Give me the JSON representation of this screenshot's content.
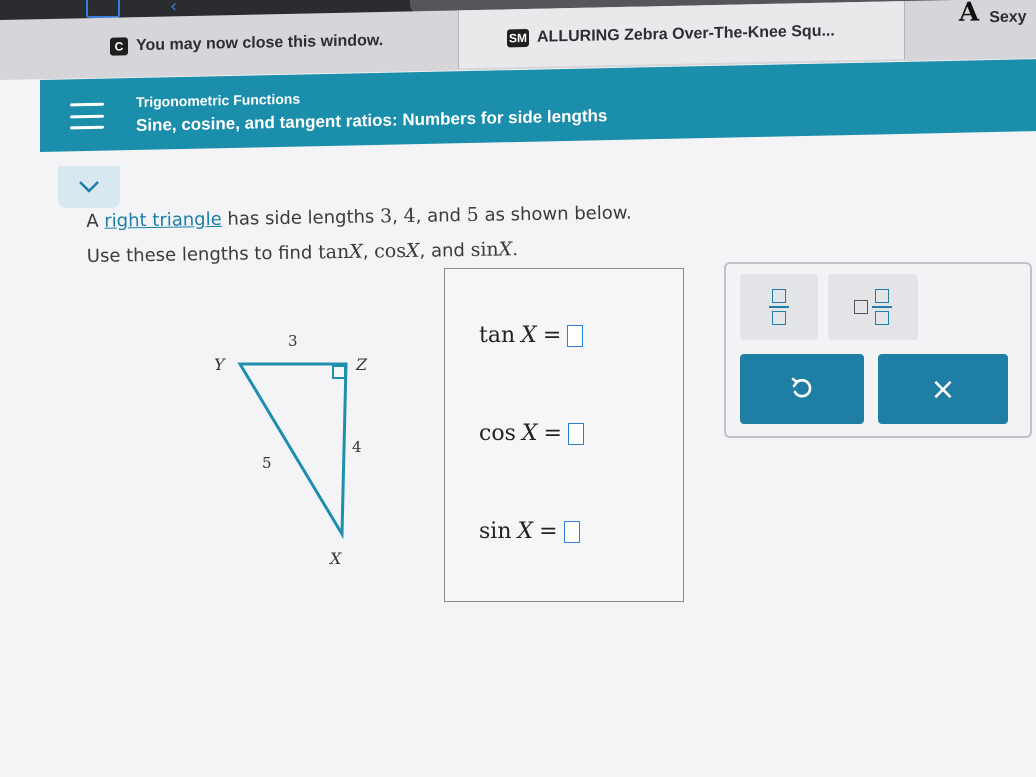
{
  "tabs": [
    {
      "favicon": "C",
      "label": "You may now close this window."
    },
    {
      "favicon": "SM",
      "label": "ALLURING Zebra Over-The-Knee Squ..."
    },
    {
      "favicon": "A",
      "label": "Sexy"
    }
  ],
  "header": {
    "subtitle": "Trigonometric Functions",
    "title": "Sine, cosine, and tangent ratios: Numbers for side lengths"
  },
  "question": {
    "part1": "A ",
    "link": "right triangle",
    "part2": " has side lengths ",
    "a": "3",
    "b": "4",
    "c": "5",
    "part3": " as shown below.",
    "line2_prefix": "Use these lengths to find ",
    "tan": "tan",
    "cos": "cos",
    "sin": "sin",
    "var": "X",
    "and": "and"
  },
  "triangle": {
    "vertex_y": "Y",
    "vertex_z": "Z",
    "vertex_x": "X",
    "side_yz": "3",
    "side_zx": "4",
    "side_yx": "5"
  },
  "answers": [
    {
      "fn": "tan",
      "var": "X",
      "eq": "="
    },
    {
      "fn": "cos",
      "var": "X",
      "eq": "="
    },
    {
      "fn": "sin",
      "var": "X",
      "eq": "="
    }
  ],
  "keypad": {
    "undo_icon": "undo-icon",
    "clear_glyph": "×"
  },
  "colors": {
    "accent": "#1b8eab",
    "link": "#1a7fa8",
    "input_border": "#2a7fd6",
    "key_dark": "#1f7ea3"
  }
}
